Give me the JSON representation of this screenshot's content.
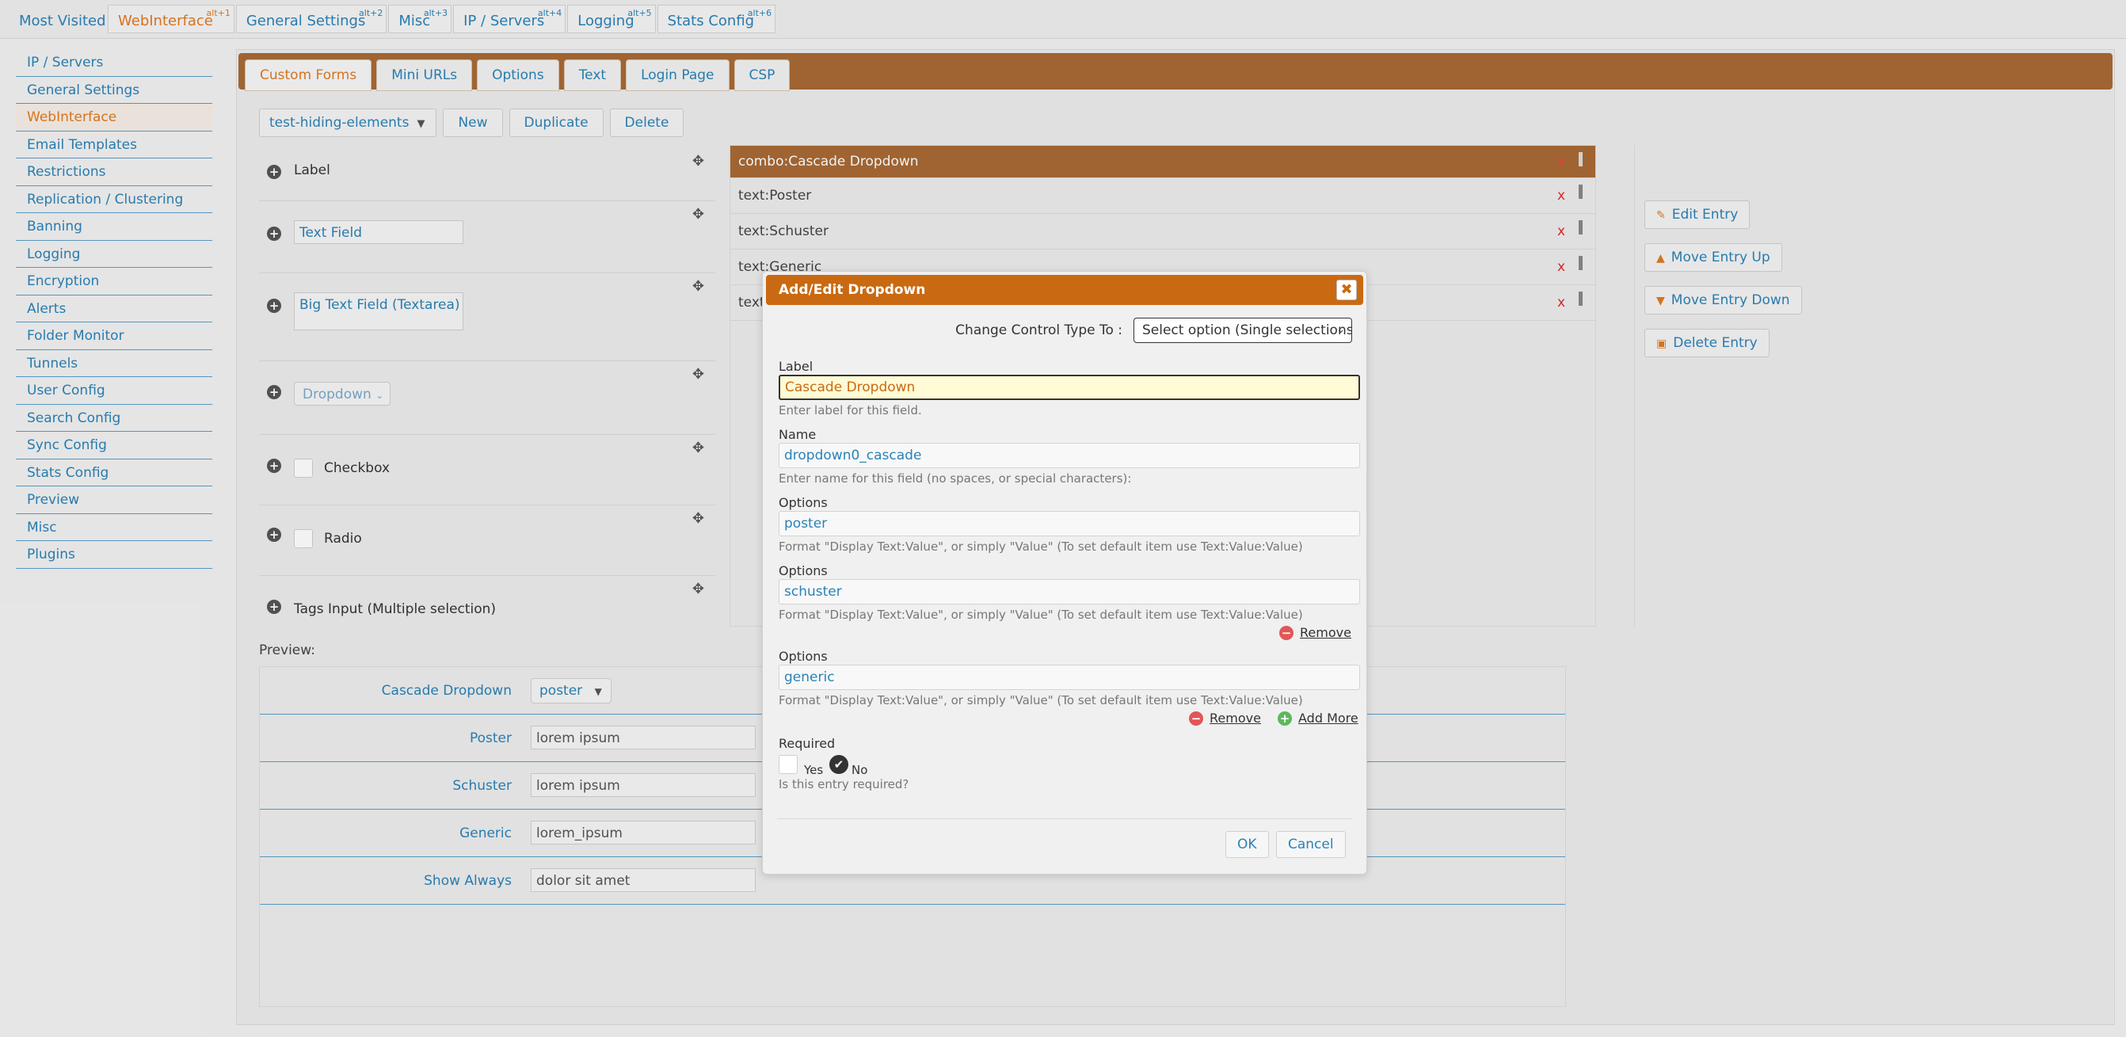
{
  "topbar": {
    "label": "Most Visited :",
    "tabs": [
      {
        "label": "WebInterface",
        "hotkey": "alt+1"
      },
      {
        "label": "General Settings",
        "hotkey": "alt+2"
      },
      {
        "label": "Misc",
        "hotkey": "alt+3"
      },
      {
        "label": "IP / Servers",
        "hotkey": "alt+4"
      },
      {
        "label": "Logging",
        "hotkey": "alt+5"
      },
      {
        "label": "Stats Config",
        "hotkey": "alt+6"
      }
    ]
  },
  "sidebar": {
    "items": [
      {
        "label": "IP / Servers"
      },
      {
        "label": "General Settings"
      },
      {
        "label": "WebInterface"
      },
      {
        "label": "Email Templates"
      },
      {
        "label": "Restrictions"
      },
      {
        "label": "Replication / Clustering"
      },
      {
        "label": "Banning"
      },
      {
        "label": "Logging"
      },
      {
        "label": "Encryption"
      },
      {
        "label": "Alerts"
      },
      {
        "label": "Folder Monitor"
      },
      {
        "label": "Tunnels"
      },
      {
        "label": "User Config"
      },
      {
        "label": "Search Config"
      },
      {
        "label": "Sync Config"
      },
      {
        "label": "Stats Config"
      },
      {
        "label": "Preview"
      },
      {
        "label": "Misc"
      },
      {
        "label": "Plugins"
      }
    ]
  },
  "main": {
    "tabs": [
      {
        "label": "Custom Forms"
      },
      {
        "label": "Mini URLs"
      },
      {
        "label": "Options"
      },
      {
        "label": "Text"
      },
      {
        "label": "Login Page"
      },
      {
        "label": "CSP"
      }
    ],
    "toolbar": {
      "form_select": "test-hiding-elements",
      "new_label": "New",
      "duplicate_label": "Duplicate",
      "delete_label": "Delete"
    },
    "elements": {
      "label": "Label",
      "text_field": "Text Field",
      "textarea": "Big Text Field (Textarea)",
      "dropdown": "Dropdown",
      "checkbox": "Checkbox",
      "radio": "Radio",
      "tags": "Tags Input (Multiple selection)"
    },
    "form_rows": [
      {
        "label": "combo:Cascade Dropdown"
      },
      {
        "label": "text:Poster"
      },
      {
        "label": "text:Schuster"
      },
      {
        "label": "text:Generic"
      },
      {
        "label": "text:"
      }
    ],
    "remove_glyph": "x",
    "actions": {
      "edit": "Edit Entry",
      "up": "Move Entry Up",
      "down": "Move Entry Down",
      "delete": "Delete Entry"
    },
    "preview": {
      "title": "Preview:",
      "rows": [
        {
          "label": "Cascade Dropdown",
          "value": "poster"
        },
        {
          "label": "Poster",
          "value": "lorem ipsum"
        },
        {
          "label": "Schuster",
          "value": "lorem ipsum"
        },
        {
          "label": "Generic",
          "value": "lorem_ipsum"
        },
        {
          "label": "Show Always",
          "value": "dolor sit amet"
        }
      ]
    }
  },
  "dialog": {
    "title": "Add/Edit Dropdown",
    "control_type_label": "Change Control Type To :",
    "control_type_value": "Select option (Single selections",
    "label_field": {
      "label": "Label",
      "value": "Cascade Dropdown",
      "help": "Enter label for this field."
    },
    "name_field": {
      "label": "Name",
      "value": "dropdown0_cascade",
      "help": "Enter name for this field (no spaces, or special characters):"
    },
    "options": [
      {
        "label": "Options",
        "value": "poster",
        "help": "Format \"Display Text:Value\", or simply \"Value\" (To set default item use Text:Value:Value)"
      },
      {
        "label": "Options",
        "value": "schuster",
        "help": "Format \"Display Text:Value\", or simply \"Value\" (To set default item use Text:Value:Value)"
      },
      {
        "label": "Options",
        "value": "generic",
        "help": "Format \"Display Text:Value\", or simply \"Value\" (To set default item use Text:Value:Value)"
      }
    ],
    "remove_label": "Remove",
    "add_more_label": "Add More",
    "required": {
      "label": "Required",
      "yes": "Yes",
      "no": "No",
      "help": "Is this entry required?"
    },
    "ok_label": "OK",
    "cancel_label": "Cancel"
  }
}
